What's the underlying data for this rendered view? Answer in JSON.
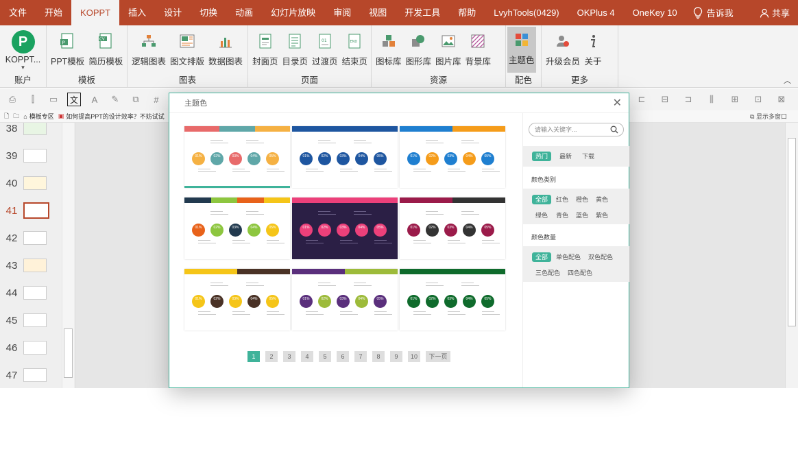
{
  "menu": [
    "文件",
    "开始",
    "KOPPT",
    "插入",
    "设计",
    "切换",
    "动画",
    "幻灯片放映",
    "审阅",
    "视图",
    "开发工具",
    "帮助",
    "LvyhTools(0429)",
    "OKPlus 4",
    "OneKey 10"
  ],
  "menu_tellme": "告诉我",
  "menu_share": "共享",
  "ribbon": {
    "account": {
      "label": "账户",
      "button": "KOPPT..."
    },
    "template": {
      "label": "模板",
      "items": [
        "PPT模板",
        "简历模板"
      ]
    },
    "chart": {
      "label": "图表",
      "items": [
        "逻辑图表",
        "图文排版",
        "数据图表"
      ]
    },
    "page": {
      "label": "页面",
      "items": [
        "封面页",
        "目录页",
        "过渡页",
        "结束页"
      ]
    },
    "resource": {
      "label": "资源",
      "items": [
        "图标库",
        "图形库",
        "图片库",
        "背景库"
      ]
    },
    "color": {
      "label": "配色",
      "items": [
        "主题色"
      ]
    },
    "more": {
      "label": "更多",
      "items": [
        "升级会员",
        "关于"
      ]
    }
  },
  "tabs": [
    "模板专区",
    "如何提高PPT的设计效率？不妨试试"
  ],
  "multiwindow": "显示多窗口",
  "slides": [
    "38",
    "39",
    "40",
    "41",
    "42",
    "43",
    "44",
    "45",
    "46",
    "47"
  ],
  "dialog": {
    "title": "主题色",
    "search_placeholder": "请输入关键字...",
    "sort_tabs": [
      "热门",
      "最新",
      "下载"
    ],
    "color_category": {
      "label": "颜色类别",
      "options": [
        "全部",
        "红色",
        "橙色",
        "黄色",
        "绿色",
        "青色",
        "蓝色",
        "紫色"
      ]
    },
    "color_count": {
      "label": "颜色数量",
      "options": [
        "全部",
        "单色配色",
        "双色配色",
        "三色配色",
        "四色配色"
      ]
    },
    "pagination": [
      "1",
      "2",
      "3",
      "4",
      "5",
      "6",
      "7",
      "8",
      "9",
      "10"
    ],
    "current_page": "1",
    "next_label": "下一页",
    "circle_labels": [
      "01%",
      "02%",
      "03%",
      "04%",
      "05%"
    ],
    "themes": [
      {
        "bar": [
          "#e86a6a",
          "#5fa7a8",
          "#f5b143"
        ],
        "circles": [
          "#f5b143",
          "#5fa7a8",
          "#e86a6a",
          "#5fa7a8",
          "#f5b143"
        ],
        "bg": "#ffffff",
        "selected": true
      },
      {
        "bar": [
          "#1e56a0"
        ],
        "circles": [
          "#1e56a0",
          "#1e56a0",
          "#1e56a0",
          "#1e56a0",
          "#1e56a0"
        ],
        "bg": "#ffffff",
        "selected": false
      },
      {
        "bar": [
          "#1f7fd0",
          "#f59c1a"
        ],
        "circles": [
          "#1f7fd0",
          "#f59c1a",
          "#1f7fd0",
          "#f59c1a",
          "#1f7fd0"
        ],
        "bg": "#ffffff",
        "selected": false
      },
      {
        "bar": [
          "#223a4f",
          "#8dc63f",
          "#e8621a",
          "#f5c518"
        ],
        "circles": [
          "#e8621a",
          "#8dc63f",
          "#223a4f",
          "#8dc63f",
          "#f5c518"
        ],
        "bg": "#ffffff",
        "selected": false
      },
      {
        "bar": [
          "#ec407a"
        ],
        "circles": [
          "#ec407a",
          "#ec407a",
          "#ec407a",
          "#ec407a",
          "#ec407a"
        ],
        "bg": "#2b1f45",
        "selected": false
      },
      {
        "bar": [
          "#9b1b4a",
          "#333333"
        ],
        "circles": [
          "#9b1b4a",
          "#333333",
          "#9b1b4a",
          "#333333",
          "#9b1b4a"
        ],
        "bg": "#ffffff",
        "selected": false
      },
      {
        "bar": [
          "#f5c518",
          "#4a3226"
        ],
        "circles": [
          "#f5c518",
          "#4a3226",
          "#f5c518",
          "#4a3226",
          "#f5c518"
        ],
        "bg": "#ffffff",
        "selected": false
      },
      {
        "bar": [
          "#5a2f7c",
          "#9dbb3a"
        ],
        "circles": [
          "#5a2f7c",
          "#9dbb3a",
          "#5a2f7c",
          "#9dbb3a",
          "#5a2f7c"
        ],
        "bg": "#ffffff",
        "selected": false
      },
      {
        "bar": [
          "#0f6b2c"
        ],
        "circles": [
          "#0f6b2c",
          "#0f6b2c",
          "#0f6b2c",
          "#0f6b2c",
          "#0f6b2c"
        ],
        "bg": "#ffffff",
        "selected": false
      }
    ]
  },
  "colors": {
    "brand": "#b7472a",
    "accent": "#3fb39a"
  }
}
